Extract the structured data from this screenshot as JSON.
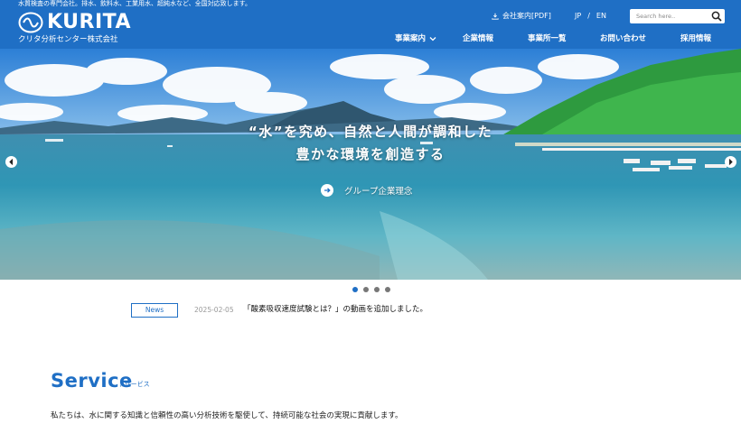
{
  "header": {
    "tagline": "水質検査の専門会社。排水、飲料水、工業用水、超純水など、全国対応致します。",
    "logo_text": "KURITA",
    "logo_sub": "クリタ分析センター株式会社",
    "pdf_link": "会社案内[PDF]",
    "lang_jp": "JP",
    "lang_sep": "/",
    "lang_en": "EN",
    "search_placeholder": "Search here..",
    "nav": [
      {
        "label": "事業案内",
        "has_dropdown": true
      },
      {
        "label": "企業情報"
      },
      {
        "label": "事業所一覧"
      },
      {
        "label": "お問い合わせ"
      },
      {
        "label": "採用情報"
      }
    ]
  },
  "hero": {
    "line1": "“水”を究め、自然と人間が調和した",
    "line2": "豊かな環境を創造する",
    "cta_label": "グループ企業理念"
  },
  "carousel": {
    "slides": 4,
    "active": 1
  },
  "news": {
    "badge": "News",
    "date": "2025-02-05",
    "title": "「酸素吸収速度試験とは？」の動画を追加しました。"
  },
  "service": {
    "title": "Service",
    "subtitle": "/ サービス",
    "description": "私たちは、水に関する知識と信頼性の高い分析技術を駆使して、持続可能な社会の実現に貢献します。"
  },
  "colors": {
    "brand": "#1f6fc5",
    "dot_inactive": "#777777"
  }
}
